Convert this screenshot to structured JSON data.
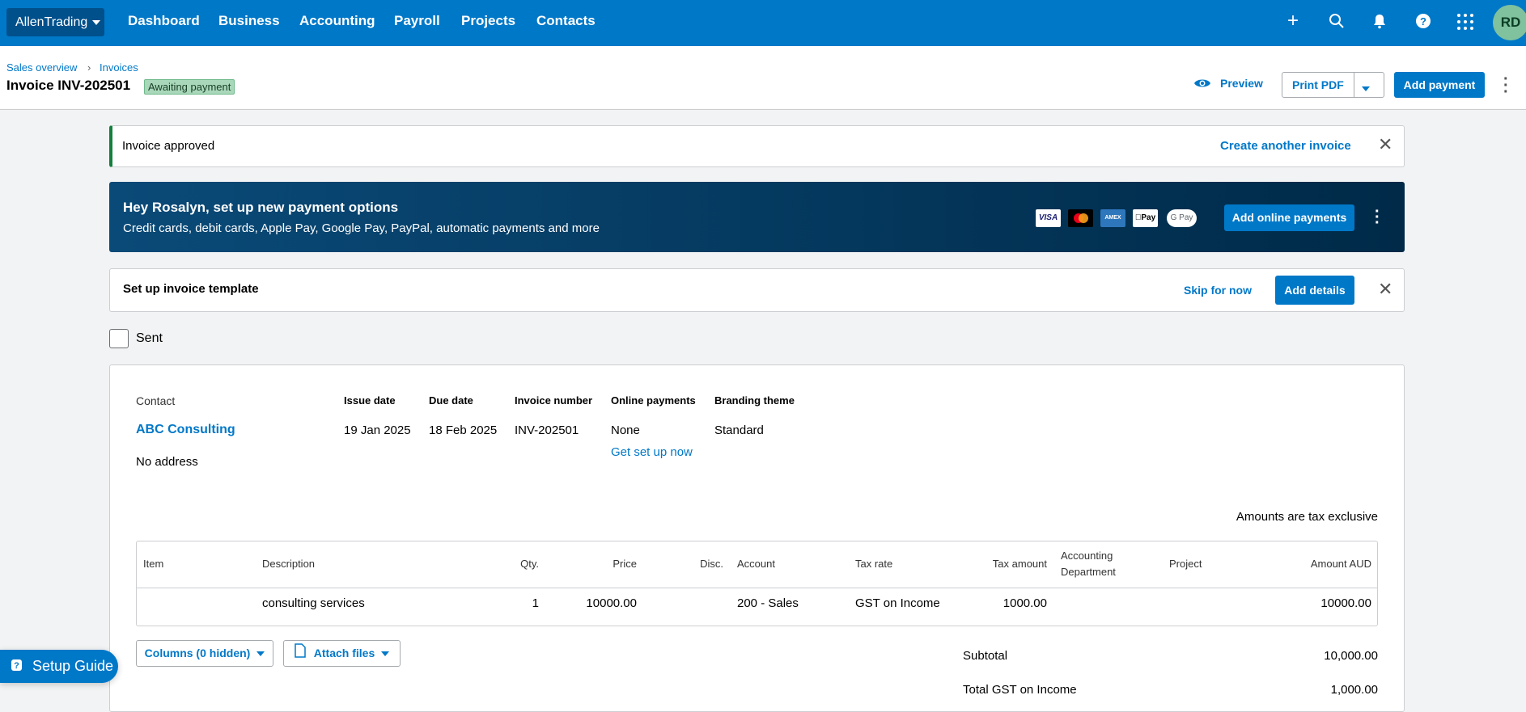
{
  "topbar": {
    "org": "AllenTrading",
    "nav": [
      "Dashboard",
      "Business",
      "Accounting",
      "Payroll",
      "Projects",
      "Contacts"
    ],
    "avatar": "RD"
  },
  "header": {
    "breadcrumb": [
      "Sales overview",
      "Invoices"
    ],
    "title": "Invoice INV-202501",
    "status": "Awaiting payment",
    "preview": "Preview",
    "print_pdf": "Print PDF",
    "add_payment": "Add payment"
  },
  "approved_banner": {
    "text": "Invoice approved",
    "action": "Create another invoice"
  },
  "payment_banner": {
    "title": "Hey Rosalyn, set up new payment options",
    "subtitle": "Credit cards, debit cards, Apple Pay, Google Pay, PayPal, automatic payments and more",
    "methods": [
      "VISA",
      "MC",
      "AMEX",
      "Pay",
      "G Pay"
    ],
    "button": "Add online payments"
  },
  "template_box": {
    "title": "Set up invoice template",
    "skip": "Skip for now",
    "add": "Add details"
  },
  "sent_label": "Sent",
  "invoice": {
    "contact_label": "Contact",
    "contact": "ABC Consulting",
    "address": "No address",
    "issue_date_label": "Issue date",
    "issue_date": "19 Jan 2025",
    "due_date_label": "Due date",
    "due_date": "18 Feb 2025",
    "number_label": "Invoice number",
    "number": "INV-202501",
    "online_label": "Online payments",
    "online": "None",
    "online_link": "Get set up now",
    "branding_label": "Branding theme",
    "branding": "Standard",
    "tax_note": "Amounts are tax exclusive"
  },
  "table": {
    "headers": {
      "item": "Item",
      "description": "Description",
      "qty": "Qty.",
      "price": "Price",
      "disc": "Disc.",
      "account": "Account",
      "tax_rate": "Tax rate",
      "tax_amount": "Tax amount",
      "dept_1": "Accounting",
      "dept_2": "Department",
      "project": "Project",
      "amount": "Amount AUD"
    },
    "rows": [
      {
        "item": "",
        "description": "consulting services",
        "qty": "1",
        "price": "10000.00",
        "disc": "",
        "account": "200 - Sales",
        "tax_rate": "GST on Income",
        "tax_amount": "1000.00",
        "dept": "",
        "project": "",
        "amount": "10000.00"
      }
    ]
  },
  "actions": {
    "columns": "Columns (0 hidden)",
    "attach": "Attach files"
  },
  "totals": {
    "subtotal_label": "Subtotal",
    "subtotal": "10,000.00",
    "gst_label": "Total GST on Income",
    "gst": "1,000.00"
  },
  "setup_guide": "Setup Guide"
}
